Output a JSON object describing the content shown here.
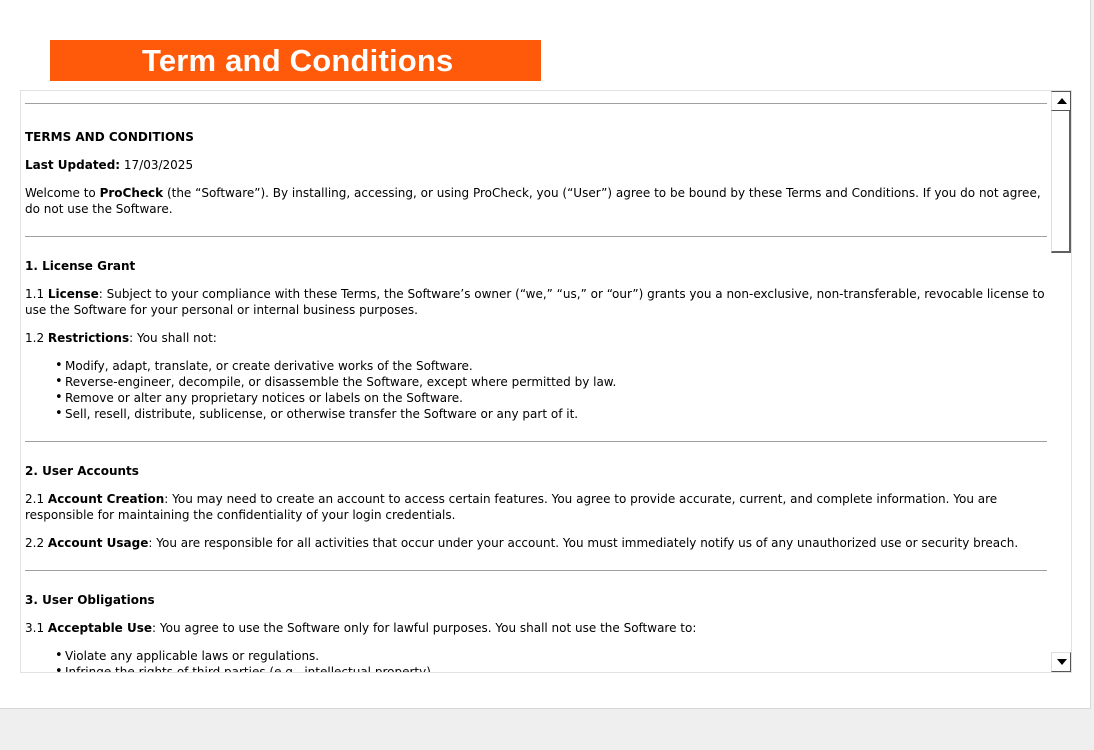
{
  "header": {
    "title": "Term and Conditions"
  },
  "document": {
    "heading": "TERMS AND CONDITIONS",
    "last_updated_label": "Last Updated:",
    "last_updated_value": " 17/03/2025",
    "intro": {
      "pre": "Welcome to ",
      "product": "ProCheck",
      "post": " (the “Software”). By installing, accessing, or using ProCheck, you (“User”) agree to be bound by these Terms and Conditions. If you do not agree, do not use the Software."
    },
    "sections": [
      {
        "title": "1. License Grant",
        "p1_num": "1.1 ",
        "p1_bold": "License",
        "p1_text": ": Subject to your compliance with these Terms, the Software’s owner (“we,” “us,” or “our”) grants you a non-exclusive, non-transferable, revocable license to use the Software for your personal or internal business purposes.",
        "p2_num": "1.2 ",
        "p2_bold": "Restrictions",
        "p2_text": ": You shall not:",
        "bullets": [
          "Modify, adapt, translate, or create derivative works of the Software.",
          "Reverse-engineer, decompile, or disassemble the Software, except where permitted by law.",
          "Remove or alter any proprietary notices or labels on the Software.",
          "Sell, resell, distribute, sublicense, or otherwise transfer the Software or any part of it."
        ]
      },
      {
        "title": "2. User Accounts",
        "p1_num": "2.1 ",
        "p1_bold": "Account Creation",
        "p1_text": ": You may need to create an account to access certain features. You agree to provide accurate, current, and complete information. You are responsible for maintaining the confidentiality of your login credentials.",
        "p2_num": "2.2 ",
        "p2_bold": "Account Usage",
        "p2_text": ": You are responsible for all activities that occur under your account. You must immediately notify us of any unauthorized use or security breach."
      },
      {
        "title": "3. User Obligations",
        "p1_num": "3.1 ",
        "p1_bold": "Acceptable Use",
        "p1_text": ": You agree to use the Software only for lawful purposes. You shall not use the Software to:",
        "bullets": [
          "Violate any applicable laws or regulations.",
          "Infringe the rights of third parties (e.g., intellectual property)."
        ]
      }
    ]
  },
  "icons": {
    "scroll_up": "arrow-up-icon",
    "scroll_down": "arrow-down-icon"
  },
  "colors": {
    "banner": "#ff5a0a"
  }
}
